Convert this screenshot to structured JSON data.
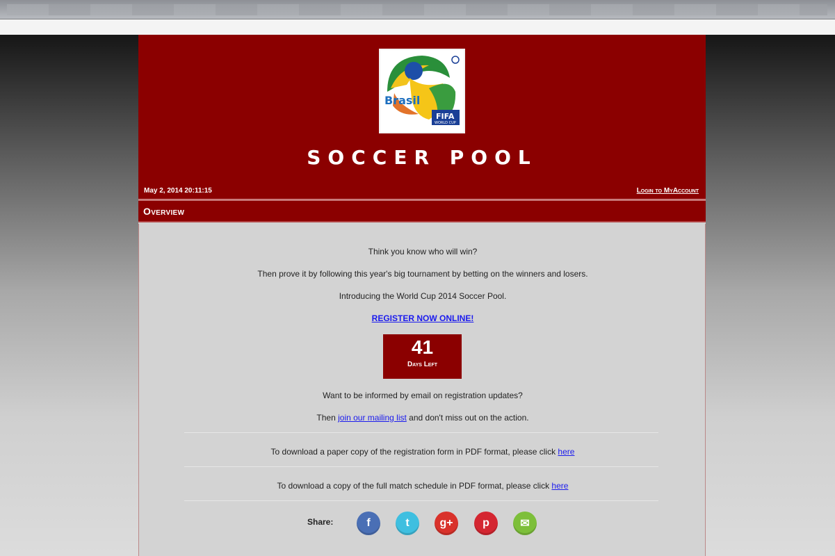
{
  "header": {
    "title": "SOCCER POOL",
    "date": "May 2, 2014 20:11:15",
    "login_link": "Login to MyAccount",
    "logo_text": {
      "brasil": "Brasil",
      "fifa": "FIFA",
      "world_cup": "WORLD CUP"
    }
  },
  "section": {
    "title": "Overview"
  },
  "intro": {
    "line1": "Think you know who will win?",
    "line2": "Then prove it by following this year's big tournament by betting on the winners and losers.",
    "line3": "Introducing the World Cup 2014 Soccer Pool.",
    "register_link": "REGISTER NOW ONLINE!"
  },
  "countdown": {
    "days": "41",
    "label": "Days Left"
  },
  "mailing": {
    "question": "Want to be informed by email on registration updates?",
    "prefix": "Then",
    "link": "join our mailing list",
    "suffix": "and don't miss out on the action."
  },
  "downloads": [
    {
      "text": "To download a paper copy of the registration form in PDF format, please click",
      "link": "here"
    },
    {
      "text": "To download a copy of the full match schedule in PDF format, please click",
      "link": "here"
    }
  ],
  "share": {
    "label": "Share:",
    "icons": [
      {
        "name": "facebook-icon",
        "glyph": "f",
        "color": "#4a6fb5"
      },
      {
        "name": "twitter-icon",
        "glyph": "t",
        "color": "#3fbfe0"
      },
      {
        "name": "google-plus-icon",
        "glyph": "g+",
        "color": "#d9322b"
      },
      {
        "name": "pinterest-icon",
        "glyph": "p",
        "color": "#d42631"
      },
      {
        "name": "email-icon",
        "glyph": "✉",
        "color": "#7dbf3a"
      }
    ]
  },
  "colors": {
    "header_bg": "#8b0000",
    "link": "#1a1aee",
    "content_bg": "#d3d3d3"
  }
}
